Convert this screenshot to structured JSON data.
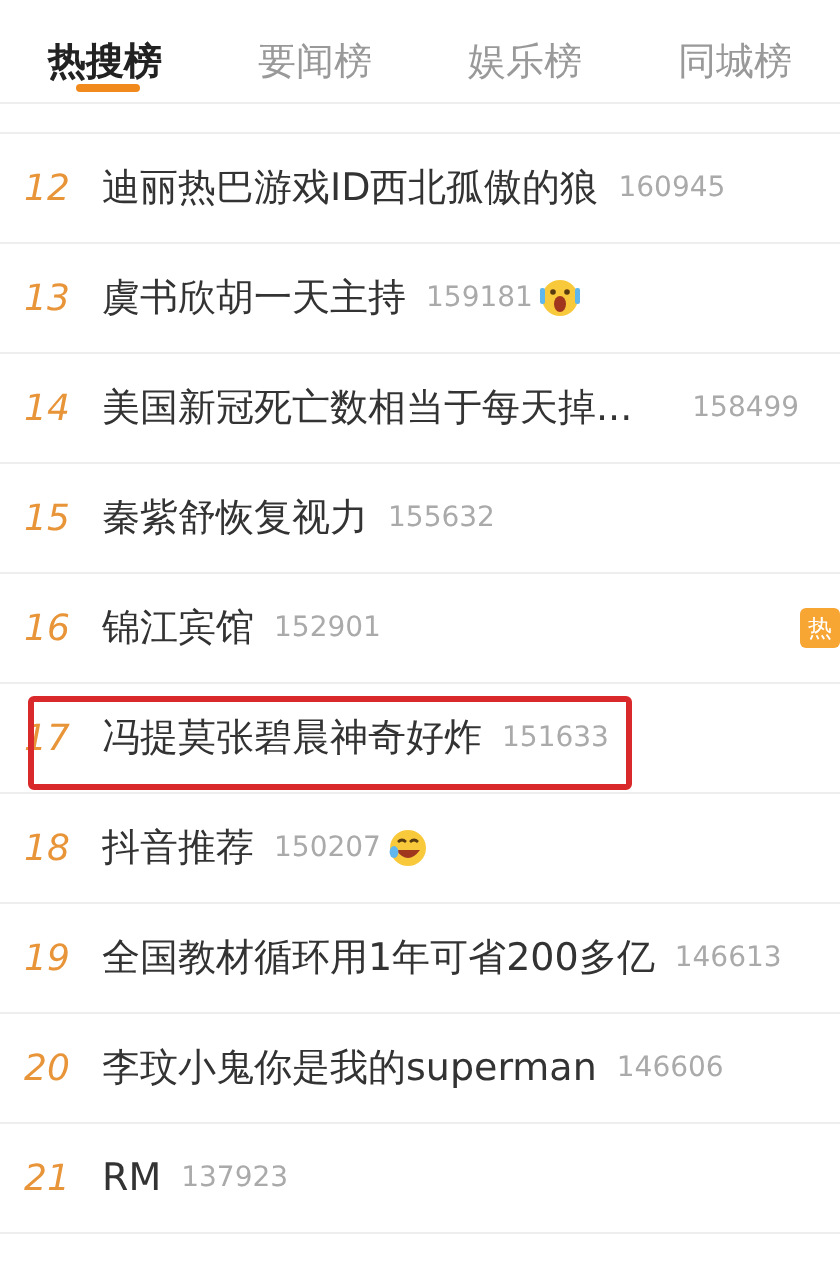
{
  "tabs": [
    {
      "label": "热搜榜",
      "selected": true
    },
    {
      "label": "要闻榜",
      "selected": false
    },
    {
      "label": "娱乐榜",
      "selected": false
    },
    {
      "label": "同城榜",
      "selected": false
    }
  ],
  "rows": [
    {
      "rank": "12",
      "title": "迪丽热巴游戏ID西北孤傲的狼",
      "count": "160945",
      "highlighted": false
    },
    {
      "rank": "13",
      "title": "虞书欣胡一天主持",
      "count": "159181",
      "kind": "shocked",
      "highlighted": false
    },
    {
      "rank": "14",
      "title": "美国新冠死亡数相当于每天掉...",
      "count": "158499",
      "highlighted": false
    },
    {
      "rank": "15",
      "title": "秦紫舒恢复视力",
      "count": "155632",
      "highlighted": false
    },
    {
      "rank": "16",
      "title": "锦江宾馆",
      "count": "152901",
      "badge": "热",
      "highlighted": false
    },
    {
      "rank": "17",
      "title": "冯提莫张碧晨神奇好炸",
      "count": "151633",
      "highlighted": true
    },
    {
      "rank": "18",
      "title": "抖音推荐",
      "count": "150207",
      "kind": "laughing",
      "highlighted": false
    },
    {
      "rank": "19",
      "title": "全国教材循环用1年可省200多亿",
      "count": "146613",
      "highlighted": false
    },
    {
      "rank": "20",
      "title": "李玟小鬼你是我的superman",
      "count": "146606",
      "highlighted": false
    },
    {
      "rank": "21",
      "title": "RM",
      "count": "137923",
      "highlighted": false
    }
  ]
}
